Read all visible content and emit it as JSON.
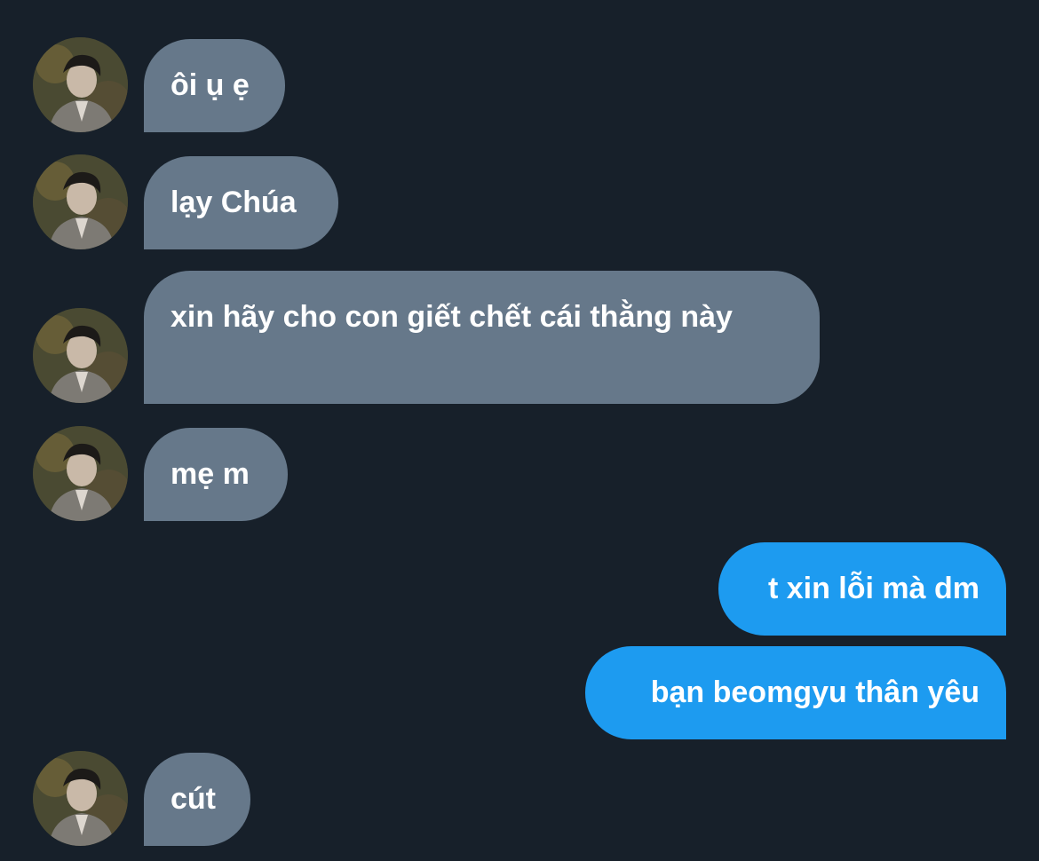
{
  "conversation": {
    "messages": [
      {
        "sender": "them",
        "text": "ôi ụ ẹ"
      },
      {
        "sender": "them",
        "text": "lạy Chúa"
      },
      {
        "sender": "them",
        "text": "xin hãy cho con giết chết cái thằng này"
      },
      {
        "sender": "them",
        "text": "mẹ m"
      },
      {
        "sender": "me",
        "text": "t xin lỗi mà dm"
      },
      {
        "sender": "me",
        "text": "bạn beomgyu thân yêu"
      },
      {
        "sender": "them",
        "text": "cút"
      }
    ]
  },
  "colors": {
    "background": "#17202a",
    "incoming_bubble": "#66788a",
    "outgoing_bubble": "#1d9bf0",
    "text": "#ffffff"
  },
  "icons": {
    "avatar": "profile-photo-avatar"
  }
}
